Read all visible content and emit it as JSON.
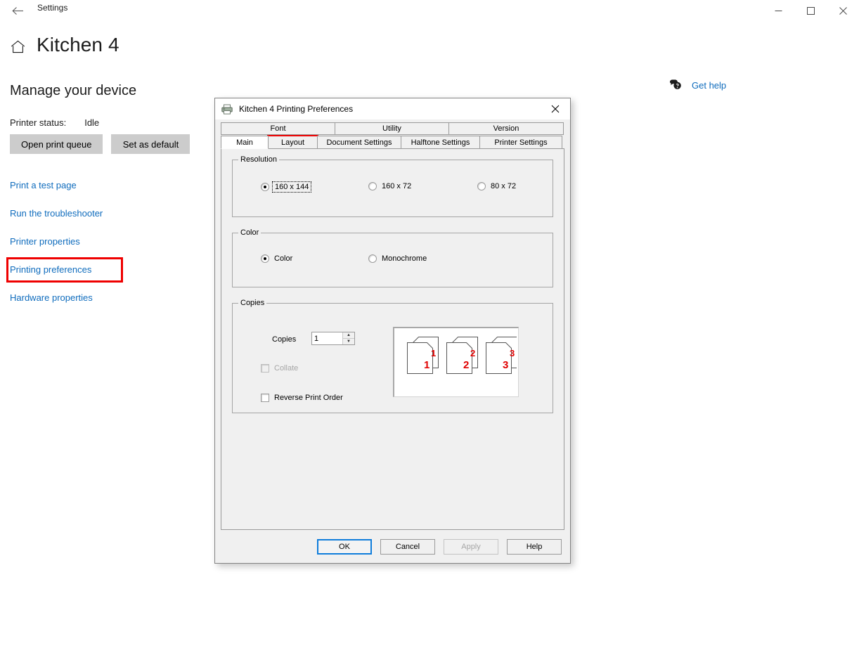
{
  "settings_window": {
    "title": "Settings",
    "back_icon": "back-arrow-icon",
    "controls": {
      "minimize": "minimize-icon",
      "maximize": "maximize-icon",
      "close": "close-icon"
    }
  },
  "page": {
    "home_icon": "home-icon",
    "title": "Kitchen 4",
    "section_title": "Manage your device",
    "status_label": "Printer status:",
    "status_value": "Idle",
    "buttons": [
      {
        "label": "Open print queue"
      },
      {
        "label": "Set as default"
      }
    ],
    "links": [
      {
        "label": "Print a test page",
        "highlighted": false
      },
      {
        "label": "Run the troubleshooter",
        "highlighted": false
      },
      {
        "label": "Printer properties",
        "highlighted": false
      },
      {
        "label": "Printing preferences",
        "highlighted": true
      },
      {
        "label": "Hardware properties",
        "highlighted": false
      }
    ],
    "get_help": {
      "label": "Get help",
      "icon": "help-bubble-icon"
    }
  },
  "dialog": {
    "icon": "printer-icon",
    "title": "Kitchen 4 Printing Preferences",
    "close_icon": "close-icon",
    "tabs_top": [
      {
        "label": "Font"
      },
      {
        "label": "Utility"
      },
      {
        "label": "Version"
      }
    ],
    "tabs_bottom": [
      {
        "label": "Main",
        "selected": true,
        "boxed": false
      },
      {
        "label": "Layout",
        "selected": false,
        "boxed": true
      },
      {
        "label": "Document Settings",
        "selected": false,
        "boxed": false
      },
      {
        "label": "Halftone Settings",
        "selected": false,
        "boxed": false
      },
      {
        "label": "Printer Settings",
        "selected": false,
        "boxed": false
      }
    ],
    "resolution": {
      "group_label": "Resolution",
      "options": [
        {
          "label": "160 x 144",
          "checked": true,
          "focused": true
        },
        {
          "label": "160 x 72",
          "checked": false,
          "focused": false
        },
        {
          "label": "80 x 72",
          "checked": false,
          "focused": false
        }
      ]
    },
    "color": {
      "group_label": "Color",
      "options": [
        {
          "label": "Color",
          "checked": true
        },
        {
          "label": "Monochrome",
          "checked": false
        }
      ]
    },
    "copies": {
      "group_label": "Copies",
      "copies_label": "Copies",
      "copies_value": "1",
      "spin_up": "▲",
      "spin_down": "▼",
      "collate_label": "Collate",
      "collate_checked": false,
      "collate_disabled": true,
      "reverse_label": "Reverse Print Order",
      "reverse_checked": false,
      "preview_numbers": [
        "1",
        "2",
        "3"
      ],
      "preview_number_color": "#e00000"
    },
    "buttons": [
      {
        "label": "OK",
        "style": "default"
      },
      {
        "label": "Cancel",
        "style": "normal"
      },
      {
        "label": "Apply",
        "style": "disabled"
      },
      {
        "label": "Help",
        "style": "normal"
      }
    ]
  },
  "colors": {
    "link": "#0f6cbd",
    "highlight_box": "#ef0000",
    "dialog_face": "#f0f0f0",
    "default_button_border": "#0f7ddb"
  }
}
